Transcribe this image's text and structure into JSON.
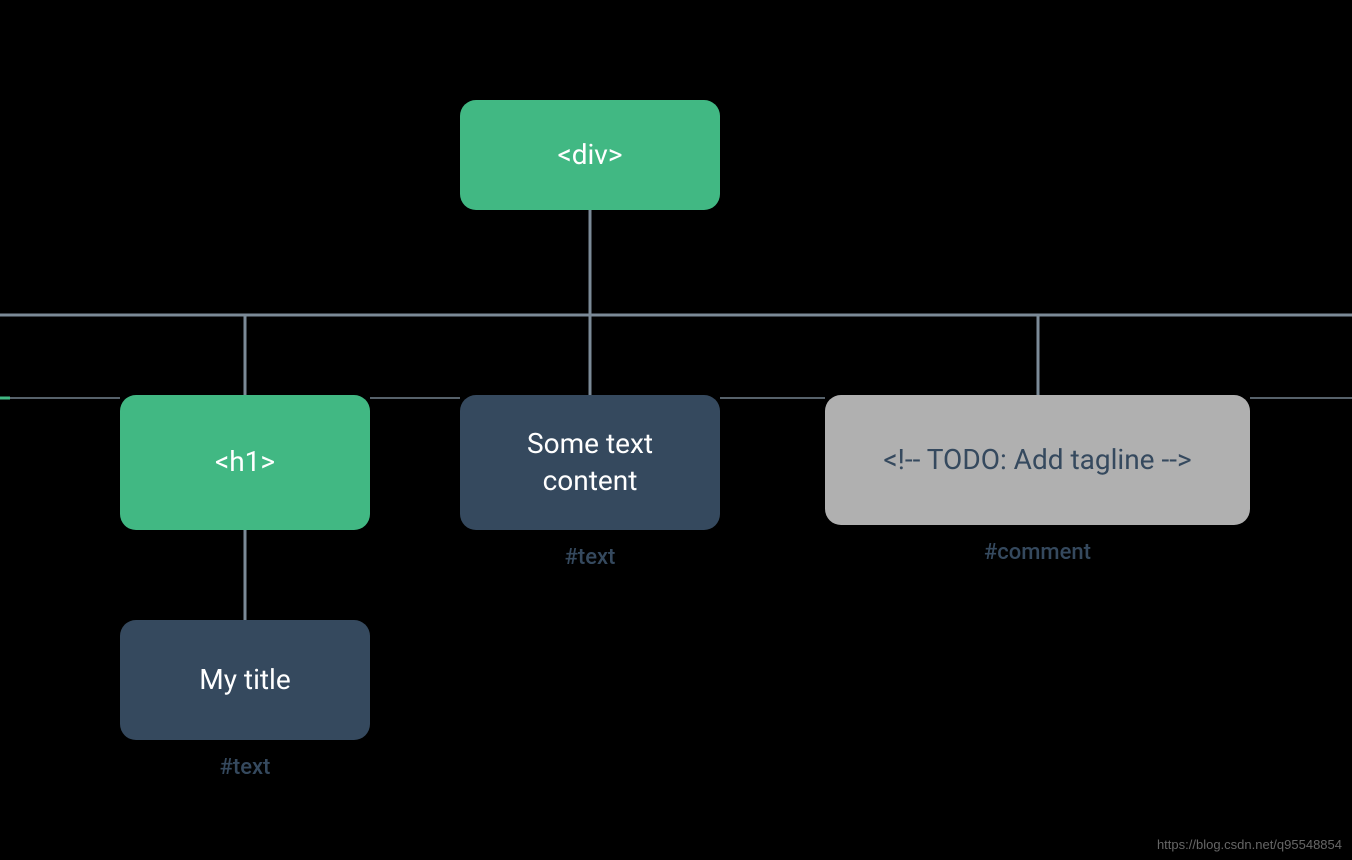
{
  "nodes": {
    "root": {
      "label": "<div>"
    },
    "h1": {
      "label": "<h1>"
    },
    "text1": {
      "label": "Some text content"
    },
    "comment": {
      "label": "<!-- TODO: Add tagline  -->"
    },
    "title": {
      "label": "My title"
    }
  },
  "captions": {
    "text1": "#text",
    "comment": "#comment",
    "title": "#text"
  },
  "colors": {
    "green": "#41b883",
    "dark": "#35495e",
    "grey": "#b0b0b0",
    "line": "#7b8a97"
  },
  "watermark": "https://blog.csdn.net/q95548854"
}
